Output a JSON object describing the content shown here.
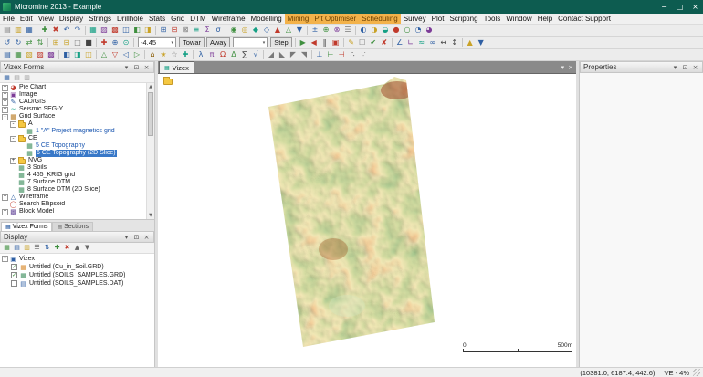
{
  "window": {
    "title": "Micromine 2013 - Example",
    "controls": [
      {
        "n": "minimize-button",
        "g": "−"
      },
      {
        "n": "maximize-button",
        "g": "□"
      },
      {
        "n": "close-button",
        "g": "×"
      }
    ]
  },
  "menu": {
    "items": [
      {
        "label": "File"
      },
      {
        "label": "Edit"
      },
      {
        "label": "View"
      },
      {
        "label": "Display"
      },
      {
        "label": "Strings"
      },
      {
        "label": "Drillhole"
      },
      {
        "label": "Stats"
      },
      {
        "label": "Grid"
      },
      {
        "label": "DTM"
      },
      {
        "label": "Wireframe"
      },
      {
        "label": "Modelling"
      },
      {
        "label": "Mining",
        "highlight": true
      },
      {
        "label": "Pit Optimiser",
        "highlight": true
      },
      {
        "label": "Scheduling",
        "highlight": true
      },
      {
        "label": "Survey"
      },
      {
        "label": "Plot"
      },
      {
        "label": "Scripting"
      },
      {
        "label": "Tools"
      },
      {
        "label": "Window"
      },
      {
        "label": "Help"
      },
      {
        "label": "Contact Support"
      }
    ]
  },
  "panels": {
    "header_buttons": [
      {
        "n": "panel-menu-icon",
        "g": "▾"
      },
      {
        "n": "pin-icon",
        "g": "⊡"
      },
      {
        "n": "close-icon",
        "g": "×"
      }
    ]
  },
  "toolbars": {
    "row1": [
      {
        "g": "▤",
        "c": "#8a8a8a",
        "n": "new-icon"
      },
      {
        "g": "▥",
        "c": "#c9a227",
        "n": "open-icon"
      },
      {
        "g": "▦",
        "c": "#2e5fa3",
        "n": "save-icon"
      },
      {
        "t": "s"
      },
      {
        "g": "✚",
        "c": "#3f8f3f"
      },
      {
        "g": "✖",
        "c": "#c0392b"
      },
      {
        "g": "↶",
        "c": "#2e5fa3",
        "n": "undo-icon"
      },
      {
        "g": "↷",
        "c": "#2e5fa3",
        "n": "redo-icon"
      },
      {
        "t": "s"
      },
      {
        "g": "▦",
        "c": "#16a085"
      },
      {
        "g": "▨",
        "c": "#7d3c98"
      },
      {
        "g": "▩",
        "c": "#c0392b"
      },
      {
        "g": "◫",
        "c": "#2e5fa3"
      },
      {
        "g": "◧",
        "c": "#3f8f3f"
      },
      {
        "g": "◨",
        "c": "#c9a227"
      },
      {
        "t": "s"
      },
      {
        "g": "⊞",
        "c": "#2e5fa3"
      },
      {
        "g": "⊟",
        "c": "#c0392b"
      },
      {
        "g": "⊠",
        "c": "#7a7a7a"
      },
      {
        "g": "≡",
        "c": "#16a085"
      },
      {
        "g": "Σ",
        "c": "#7d3c98"
      },
      {
        "g": "σ",
        "c": "#2e5fa3"
      },
      {
        "t": "s"
      },
      {
        "g": "◉",
        "c": "#3f8f3f"
      },
      {
        "g": "◎",
        "c": "#c9a227"
      },
      {
        "g": "◆",
        "c": "#16a085"
      },
      {
        "g": "◇",
        "c": "#2e5fa3"
      },
      {
        "g": "▲",
        "c": "#c0392b"
      },
      {
        "g": "△",
        "c": "#3f8f3f"
      },
      {
        "g": "▼",
        "c": "#2e5fa3"
      },
      {
        "t": "s"
      },
      {
        "g": "±",
        "c": "#2e5fa3"
      },
      {
        "g": "⊕",
        "c": "#3f8f3f"
      },
      {
        "g": "⊗",
        "c": "#7d3c98"
      },
      {
        "g": "☰",
        "c": "#7a7a7a"
      },
      {
        "t": "s"
      },
      {
        "g": "◐",
        "c": "#2e5fa3"
      },
      {
        "g": "◑",
        "c": "#c9a227"
      },
      {
        "g": "◒",
        "c": "#16a085"
      },
      {
        "g": "●",
        "c": "#c0392b"
      },
      {
        "g": "○",
        "c": "#3f8f3f"
      },
      {
        "g": "◔",
        "c": "#2e5fa3"
      },
      {
        "g": "◕",
        "c": "#7d3c98"
      }
    ],
    "row2": [
      {
        "g": "↺",
        "c": "#2e5fa3"
      },
      {
        "g": "↻",
        "c": "#2e5fa3"
      },
      {
        "g": "⇄",
        "c": "#3f8f3f"
      },
      {
        "g": "⇅",
        "c": "#3f8f3f"
      },
      {
        "t": "s"
      },
      {
        "g": "⊞",
        "c": "#c9a227"
      },
      {
        "g": "⊟",
        "c": "#c9a227"
      },
      {
        "g": "□",
        "c": "#7a7a7a"
      },
      {
        "g": "■",
        "c": "#444444"
      },
      {
        "t": "s"
      },
      {
        "g": "✚",
        "c": "#c0392b"
      },
      {
        "g": "⊕",
        "c": "#2e5fa3"
      },
      {
        "g": "⊙",
        "c": "#16a085"
      },
      {
        "t": "s"
      },
      {
        "t": "c",
        "v": "-4.45",
        "w": 42,
        "n": "section-distance-combo"
      },
      {
        "t": "b",
        "v": "Towar",
        "n": "toward-button"
      },
      {
        "t": "b",
        "v": "Away",
        "n": "away-button"
      },
      {
        "t": "c",
        "v": "",
        "w": 38,
        "n": "step-value-combo"
      },
      {
        "t": "b",
        "v": "Step",
        "n": "step-button"
      },
      {
        "t": "s"
      },
      {
        "g": "▶",
        "c": "#3f8f3f"
      },
      {
        "g": "◀",
        "c": "#c0392b"
      },
      {
        "g": "‖",
        "c": "#444444"
      },
      {
        "g": "▣",
        "c": "#c0392b"
      },
      {
        "t": "s"
      },
      {
        "g": "✎",
        "c": "#c9a227"
      },
      {
        "g": "☐",
        "c": "#7a7a7a"
      },
      {
        "g": "✔",
        "c": "#3f8f3f"
      },
      {
        "g": "✘",
        "c": "#c0392b"
      },
      {
        "t": "s"
      },
      {
        "g": "∠",
        "c": "#2e5fa3"
      },
      {
        "g": "∟",
        "c": "#7d3c98"
      },
      {
        "g": "≈",
        "c": "#16a085"
      },
      {
        "g": "∞",
        "c": "#2e5fa3"
      },
      {
        "g": "↔",
        "c": "#444444"
      },
      {
        "g": "↕",
        "c": "#444444"
      },
      {
        "t": "s"
      },
      {
        "g": "▲",
        "c": "#c9a227"
      },
      {
        "g": "▼",
        "c": "#2e5fa3"
      }
    ],
    "row3": [
      {
        "g": "▤",
        "c": "#2e5fa3"
      },
      {
        "g": "▦",
        "c": "#3f8f3f"
      },
      {
        "g": "▧",
        "c": "#c9a227"
      },
      {
        "g": "▨",
        "c": "#c0392b"
      },
      {
        "g": "▩",
        "c": "#7d3c98"
      },
      {
        "t": "s"
      },
      {
        "g": "◧",
        "c": "#2e5fa3"
      },
      {
        "g": "◨",
        "c": "#16a085"
      },
      {
        "g": "◫",
        "c": "#c9a227"
      },
      {
        "t": "s"
      },
      {
        "g": "△",
        "c": "#3f8f3f"
      },
      {
        "g": "▽",
        "c": "#c0392b"
      },
      {
        "g": "◁",
        "c": "#2e5fa3"
      },
      {
        "g": "▷",
        "c": "#3f8f3f"
      },
      {
        "t": "s"
      },
      {
        "g": "⌂",
        "c": "#8a5a00"
      },
      {
        "g": "★",
        "c": "#c9a227"
      },
      {
        "g": "☆",
        "c": "#7a7a7a"
      },
      {
        "g": "✚",
        "c": "#16a085"
      },
      {
        "t": "s"
      },
      {
        "g": "λ",
        "c": "#2e5fa3"
      },
      {
        "g": "π",
        "c": "#7d3c98"
      },
      {
        "g": "Ω",
        "c": "#c0392b"
      },
      {
        "g": "Δ",
        "c": "#3f8f3f"
      },
      {
        "g": "∑",
        "c": "#444444"
      },
      {
        "g": "√",
        "c": "#2e5fa3"
      },
      {
        "t": "s"
      },
      {
        "g": "◢",
        "c": "#7a7a7a"
      },
      {
        "g": "◣",
        "c": "#7a7a7a"
      },
      {
        "g": "◤",
        "c": "#7a7a7a"
      },
      {
        "g": "◥",
        "c": "#7a7a7a"
      },
      {
        "t": "s"
      },
      {
        "g": "⊥",
        "c": "#2e5fa3"
      },
      {
        "g": "⊢",
        "c": "#3f8f3f"
      },
      {
        "g": "⊣",
        "c": "#c0392b"
      },
      {
        "g": "∴",
        "c": "#444444"
      },
      {
        "g": "∵",
        "c": "#888888"
      }
    ]
  },
  "node_icons": {
    "pie": {
      "g": "◕",
      "c": "#c0392b"
    },
    "image": {
      "g": "▣",
      "c": "#7d3c98"
    },
    "cad": {
      "g": "✎",
      "c": "#2e5fa3"
    },
    "seismic": {
      "g": "≈",
      "c": "#16a085"
    },
    "grid": {
      "g": "▦",
      "c": "#b7791f"
    },
    "griditem": {
      "g": "▦",
      "c": "#3f8f5f"
    },
    "wireframe": {
      "g": "△",
      "c": "#2e5fa3"
    },
    "ellipsoid": {
      "g": "◯",
      "c": "#c0392b"
    },
    "block": {
      "g": "▩",
      "c": "#6b4f9e"
    }
  },
  "vizex_forms": {
    "title": "Vizex Forms",
    "toolbar": [
      {
        "g": "▦",
        "c": "#2e5fa3"
      },
      {
        "g": "▤",
        "c": "#999999"
      },
      {
        "g": "▥",
        "c": "#999999"
      }
    ],
    "tree": [
      {
        "label": "Pie Chart",
        "level": 0,
        "icon": "pie",
        "expand": "+"
      },
      {
        "label": "Image",
        "level": 0,
        "icon": "image",
        "expand": "+"
      },
      {
        "label": "CAD/GIS",
        "level": 0,
        "icon": "cad",
        "expand": "+"
      },
      {
        "label": "Seismic SEG-Y",
        "level": 0,
        "icon": "seismic",
        "expand": "+"
      },
      {
        "label": "Grid Surface",
        "level": 0,
        "icon": "grid",
        "expand": "-"
      },
      {
        "label": "A",
        "level": 1,
        "icon": "folder",
        "expand": "-"
      },
      {
        "label": "1 \"A\" Project magnetics grid",
        "level": 2,
        "icon": "griditem",
        "active": true
      },
      {
        "label": "CE",
        "level": 1,
        "icon": "folder",
        "expand": "-"
      },
      {
        "label": "5 CE Topography",
        "level": 2,
        "icon": "griditem",
        "active": true
      },
      {
        "label": "6 CE Topography (2D Slice)",
        "level": 2,
        "icon": "griditem",
        "active": true,
        "selected": true
      },
      {
        "label": "NVG",
        "level": 1,
        "icon": "folder",
        "expand": "+"
      },
      {
        "label": "3 Soils",
        "level": 1,
        "icon": "griditem"
      },
      {
        "label": "4 465_KRIG grid",
        "level": 1,
        "icon": "griditem"
      },
      {
        "label": "7 Surface DTM",
        "level": 1,
        "icon": "griditem"
      },
      {
        "label": "8 Surface DTM (2D Slice)",
        "level": 1,
        "icon": "griditem"
      },
      {
        "label": "Wireframe",
        "level": 0,
        "icon": "wireframe",
        "expand": "+"
      },
      {
        "label": "Search Ellipsoid",
        "level": 0,
        "icon": "ellipsoid"
      },
      {
        "label": "Block Model",
        "level": 0,
        "icon": "block",
        "expand": "+"
      }
    ],
    "tabs": [
      {
        "label": "Vizex Forms",
        "active": true,
        "icon": {
          "n": "vizex-forms-tab-icon",
          "g": "▦",
          "c": "#2e5fa3"
        }
      },
      {
        "label": "Sections",
        "active": false,
        "icon": {
          "n": "sections-tab-icon",
          "g": "▤",
          "c": "#666666"
        }
      }
    ]
  },
  "display": {
    "title": "Display",
    "toolbar": [
      {
        "g": "▦",
        "c": "#3f8f3f"
      },
      {
        "g": "▤",
        "c": "#2e5fa3"
      },
      {
        "g": "▥",
        "c": "#c9a227"
      },
      {
        "g": "☰",
        "c": "#666666"
      },
      {
        "g": "⇅",
        "c": "#2e5fa3"
      },
      {
        "g": "✚",
        "c": "#3f8f3f"
      },
      {
        "g": "✖",
        "c": "#c0392b"
      },
      {
        "g": "▲",
        "c": "#666666"
      },
      {
        "g": "▼",
        "c": "#666666"
      }
    ],
    "root": {
      "label": "Vizex",
      "icon": {
        "n": "monitor-icon",
        "g": "▣",
        "c": "#2e5fa3"
      }
    },
    "items": [
      {
        "label": "Untitled (Cu_in_Soil.GRD)",
        "checked": true,
        "icon": {
          "n": "grid-layer-icon",
          "g": "▦",
          "c": "#d98a2b"
        }
      },
      {
        "label": "Untitled (SOILS_SAMPLES.GRD)",
        "checked": true,
        "icon": {
          "n": "grid-layer-icon",
          "g": "▦",
          "c": "#3f8f5f"
        }
      },
      {
        "label": "Untitled (SOILS_SAMPLES.DAT)",
        "checked": false,
        "icon": {
          "n": "data-layer-icon",
          "g": "▤",
          "c": "#2e5fa3"
        }
      }
    ]
  },
  "main": {
    "tab_label": "Vizex",
    "tab_icon": {
      "g": "▦"
    },
    "strip_icons": [
      {
        "n": "tab-list-icon",
        "g": "▾"
      },
      {
        "n": "close-view-icon",
        "g": "×"
      }
    ],
    "scalebar": {
      "left": "0",
      "right": "500m"
    }
  },
  "properties": {
    "title": "Properties"
  },
  "statusbar": {
    "coords": "(10381.0, 6187.4, 442.6)",
    "ve": "VE - 4%"
  },
  "colors": {
    "titlebar": "#0d5c50",
    "menu_highlight": "#f3b24a",
    "selection": "#3878c8",
    "active_form_text": "#1a56b0"
  }
}
